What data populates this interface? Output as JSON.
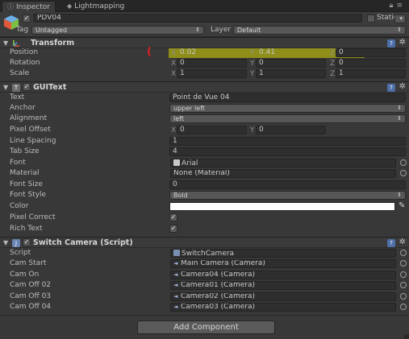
{
  "tabs": {
    "inspector": "Inspector",
    "lightmapping": "Lightmapping"
  },
  "header": {
    "object_name": "PDV04",
    "static_label": "Static",
    "tag_label": "Tag",
    "tag_value": "Untagged",
    "layer_label": "Layer",
    "layer_value": "Default",
    "active_checked": true,
    "static_checked": false
  },
  "transform": {
    "title": "Transform",
    "position": {
      "label": "Position",
      "x": "0.02",
      "y": "0.41",
      "z": "0"
    },
    "rotation": {
      "label": "Rotation",
      "x": "0",
      "y": "0",
      "z": "0"
    },
    "scale": {
      "label": "Scale",
      "x": "1",
      "y": "1",
      "z": "1"
    }
  },
  "guitext": {
    "title": "GUIText",
    "text_label": "Text",
    "text_value": "Point de Vue 04",
    "anchor_label": "Anchor",
    "anchor_value": "upper left",
    "alignment_label": "Alignment",
    "alignment_value": "left",
    "pixel_offset_label": "Pixel Offset",
    "pixel_offset_x": "0",
    "pixel_offset_y": "0",
    "line_spacing_label": "Line Spacing",
    "line_spacing_value": "1",
    "tab_size_label": "Tab Size",
    "tab_size_value": "4",
    "font_label": "Font",
    "font_value": "Arial",
    "material_label": "Material",
    "material_value": "None (Material)",
    "font_size_label": "Font Size",
    "font_size_value": "0",
    "font_style_label": "Font Style",
    "font_style_value": "Bold",
    "color_label": "Color",
    "color_value": "#ffffff",
    "pixel_correct_label": "Pixel Correct",
    "pixel_correct_checked": true,
    "rich_text_label": "Rich Text",
    "rich_text_checked": true
  },
  "switch_camera": {
    "title": "Switch Camera (Script)",
    "script_label": "Script",
    "script_value": "SwitchCamera",
    "cam_start_label": "Cam Start",
    "cam_start_value": "Main Camera (Camera)",
    "cam_on_label": "Cam On",
    "cam_on_value": "Camera04 (Camera)",
    "cam_off_02_label": "Cam Off 02",
    "cam_off_02_value": "Camera01 (Camera)",
    "cam_off_03_label": "Cam Off 03",
    "cam_off_03_value": "Camera02 (Camera)",
    "cam_off_04_label": "Cam Off 04",
    "cam_off_04_value": "Camera03 (Camera)"
  },
  "axis_labels": {
    "x": "X",
    "y": "Y",
    "z": "Z"
  },
  "add_component_label": "Add Component",
  "colors": {
    "highlight": "#d6d600",
    "annotation_mark": "#e02020",
    "panel_bg": "#383838"
  },
  "icons": [
    "info-icon",
    "lightbulb-icon",
    "lock-icon",
    "menu-icon",
    "gameobject-cube-icon",
    "transform-icon",
    "guitext-icon",
    "script-icon",
    "help-icon",
    "gear-icon",
    "object-picker-icon",
    "eyedropper-icon",
    "font-asset-icon",
    "camera-icon",
    "fold-arrow-icon",
    "dropdown-arrow-icon"
  ]
}
